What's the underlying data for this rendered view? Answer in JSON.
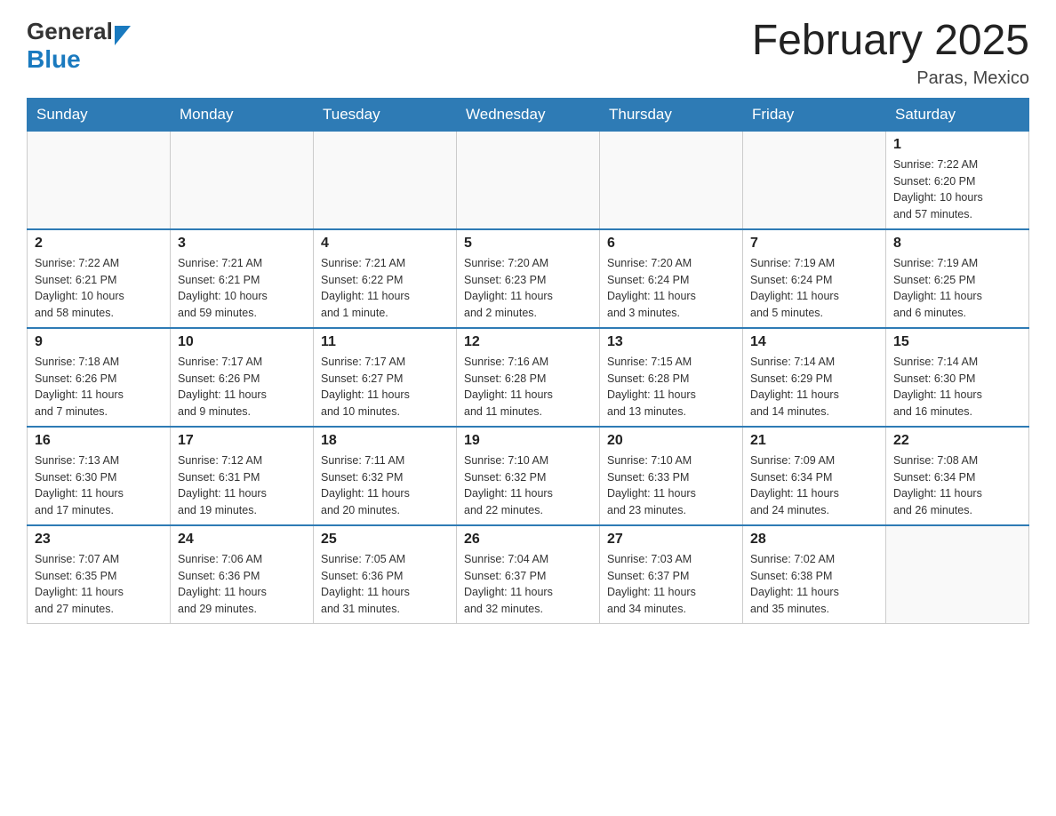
{
  "header": {
    "logo_general": "General",
    "logo_blue": "Blue",
    "title": "February 2025",
    "subtitle": "Paras, Mexico"
  },
  "days_of_week": [
    "Sunday",
    "Monday",
    "Tuesday",
    "Wednesday",
    "Thursday",
    "Friday",
    "Saturday"
  ],
  "accent_color": "#2e7bb5",
  "weeks": [
    {
      "days": [
        {
          "num": "",
          "info": ""
        },
        {
          "num": "",
          "info": ""
        },
        {
          "num": "",
          "info": ""
        },
        {
          "num": "",
          "info": ""
        },
        {
          "num": "",
          "info": ""
        },
        {
          "num": "",
          "info": ""
        },
        {
          "num": "1",
          "info": "Sunrise: 7:22 AM\nSunset: 6:20 PM\nDaylight: 10 hours\nand 57 minutes."
        }
      ]
    },
    {
      "days": [
        {
          "num": "2",
          "info": "Sunrise: 7:22 AM\nSunset: 6:21 PM\nDaylight: 10 hours\nand 58 minutes."
        },
        {
          "num": "3",
          "info": "Sunrise: 7:21 AM\nSunset: 6:21 PM\nDaylight: 10 hours\nand 59 minutes."
        },
        {
          "num": "4",
          "info": "Sunrise: 7:21 AM\nSunset: 6:22 PM\nDaylight: 11 hours\nand 1 minute."
        },
        {
          "num": "5",
          "info": "Sunrise: 7:20 AM\nSunset: 6:23 PM\nDaylight: 11 hours\nand 2 minutes."
        },
        {
          "num": "6",
          "info": "Sunrise: 7:20 AM\nSunset: 6:24 PM\nDaylight: 11 hours\nand 3 minutes."
        },
        {
          "num": "7",
          "info": "Sunrise: 7:19 AM\nSunset: 6:24 PM\nDaylight: 11 hours\nand 5 minutes."
        },
        {
          "num": "8",
          "info": "Sunrise: 7:19 AM\nSunset: 6:25 PM\nDaylight: 11 hours\nand 6 minutes."
        }
      ]
    },
    {
      "days": [
        {
          "num": "9",
          "info": "Sunrise: 7:18 AM\nSunset: 6:26 PM\nDaylight: 11 hours\nand 7 minutes."
        },
        {
          "num": "10",
          "info": "Sunrise: 7:17 AM\nSunset: 6:26 PM\nDaylight: 11 hours\nand 9 minutes."
        },
        {
          "num": "11",
          "info": "Sunrise: 7:17 AM\nSunset: 6:27 PM\nDaylight: 11 hours\nand 10 minutes."
        },
        {
          "num": "12",
          "info": "Sunrise: 7:16 AM\nSunset: 6:28 PM\nDaylight: 11 hours\nand 11 minutes."
        },
        {
          "num": "13",
          "info": "Sunrise: 7:15 AM\nSunset: 6:28 PM\nDaylight: 11 hours\nand 13 minutes."
        },
        {
          "num": "14",
          "info": "Sunrise: 7:14 AM\nSunset: 6:29 PM\nDaylight: 11 hours\nand 14 minutes."
        },
        {
          "num": "15",
          "info": "Sunrise: 7:14 AM\nSunset: 6:30 PM\nDaylight: 11 hours\nand 16 minutes."
        }
      ]
    },
    {
      "days": [
        {
          "num": "16",
          "info": "Sunrise: 7:13 AM\nSunset: 6:30 PM\nDaylight: 11 hours\nand 17 minutes."
        },
        {
          "num": "17",
          "info": "Sunrise: 7:12 AM\nSunset: 6:31 PM\nDaylight: 11 hours\nand 19 minutes."
        },
        {
          "num": "18",
          "info": "Sunrise: 7:11 AM\nSunset: 6:32 PM\nDaylight: 11 hours\nand 20 minutes."
        },
        {
          "num": "19",
          "info": "Sunrise: 7:10 AM\nSunset: 6:32 PM\nDaylight: 11 hours\nand 22 minutes."
        },
        {
          "num": "20",
          "info": "Sunrise: 7:10 AM\nSunset: 6:33 PM\nDaylight: 11 hours\nand 23 minutes."
        },
        {
          "num": "21",
          "info": "Sunrise: 7:09 AM\nSunset: 6:34 PM\nDaylight: 11 hours\nand 24 minutes."
        },
        {
          "num": "22",
          "info": "Sunrise: 7:08 AM\nSunset: 6:34 PM\nDaylight: 11 hours\nand 26 minutes."
        }
      ]
    },
    {
      "days": [
        {
          "num": "23",
          "info": "Sunrise: 7:07 AM\nSunset: 6:35 PM\nDaylight: 11 hours\nand 27 minutes."
        },
        {
          "num": "24",
          "info": "Sunrise: 7:06 AM\nSunset: 6:36 PM\nDaylight: 11 hours\nand 29 minutes."
        },
        {
          "num": "25",
          "info": "Sunrise: 7:05 AM\nSunset: 6:36 PM\nDaylight: 11 hours\nand 31 minutes."
        },
        {
          "num": "26",
          "info": "Sunrise: 7:04 AM\nSunset: 6:37 PM\nDaylight: 11 hours\nand 32 minutes."
        },
        {
          "num": "27",
          "info": "Sunrise: 7:03 AM\nSunset: 6:37 PM\nDaylight: 11 hours\nand 34 minutes."
        },
        {
          "num": "28",
          "info": "Sunrise: 7:02 AM\nSunset: 6:38 PM\nDaylight: 11 hours\nand 35 minutes."
        },
        {
          "num": "",
          "info": ""
        }
      ]
    }
  ]
}
